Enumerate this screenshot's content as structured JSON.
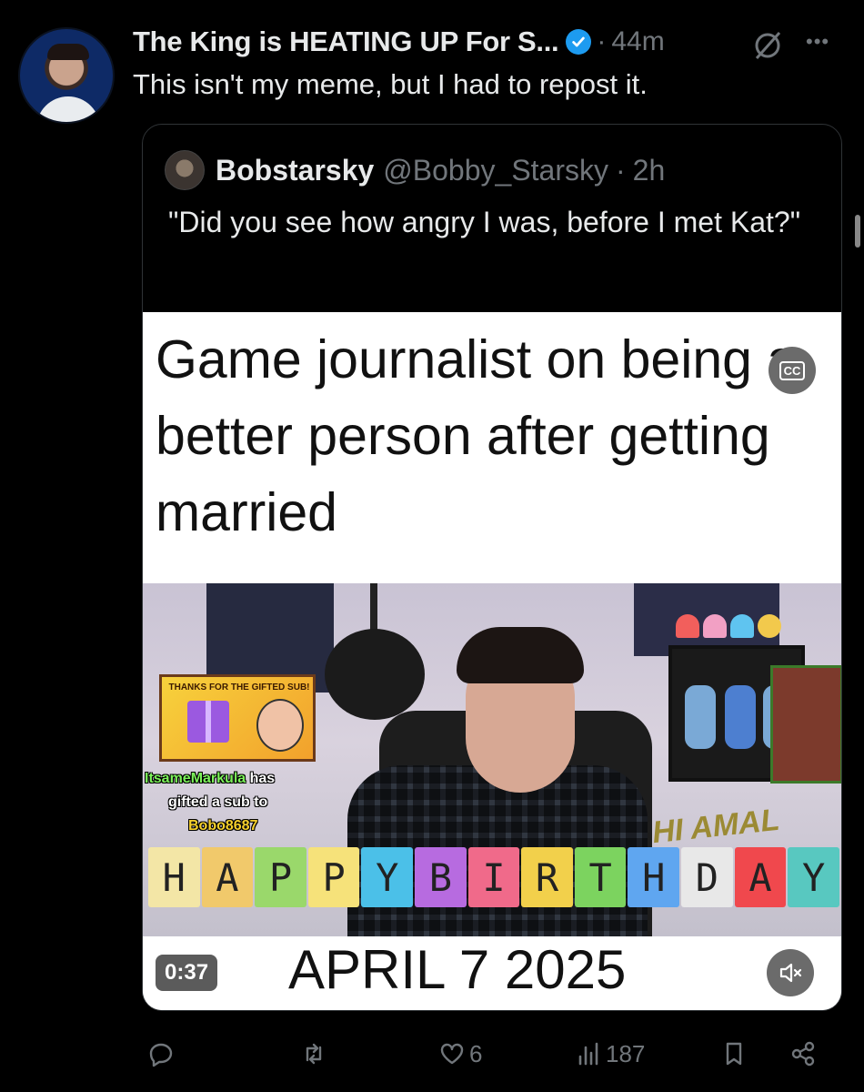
{
  "post": {
    "display_name": "The King is HEATING UP For S...",
    "time": "44m",
    "text": "This isn't my meme, but I had to repost it."
  },
  "quote": {
    "name": "Bobstarsky",
    "handle": "@Bobby_Starsky",
    "time": "2h",
    "text": "\"Did you see how angry I was, before I met Kat?\""
  },
  "media": {
    "caption": "Game journalist on being a better person after getting married",
    "cc_label": "CC",
    "gift_title": "THANKS FOR THE GIFTED SUB!",
    "gift_user": "ItsameMarkula",
    "gift_has": "has",
    "gift_line2": "gifted a sub to",
    "gift_recipient": "Bobo8687",
    "alert_word": "HI AMAL",
    "banner_letters": [
      "H",
      "A",
      "P",
      "P",
      "Y",
      "B",
      "I",
      "R",
      "T",
      "H",
      "D",
      "A",
      "Y"
    ],
    "banner_colors": [
      "#f3e6a6",
      "#f1c96b",
      "#9ad86b",
      "#f6e27a",
      "#4bc0e8",
      "#b76be0",
      "#f06a8a",
      "#f2d04b",
      "#7cd35f",
      "#5fa6f0",
      "#e8e8e8",
      "#f0484d",
      "#58c8c0"
    ],
    "date": "APRIL 7 2025",
    "duration": "0:37"
  },
  "actions": {
    "replies": "",
    "reposts": "",
    "likes": "6",
    "views": "187"
  },
  "colors": {
    "background": "#000000",
    "text": "#e7e9ea",
    "muted": "#71767b",
    "verified": "#1d9bf0",
    "border": "#2f3336"
  }
}
